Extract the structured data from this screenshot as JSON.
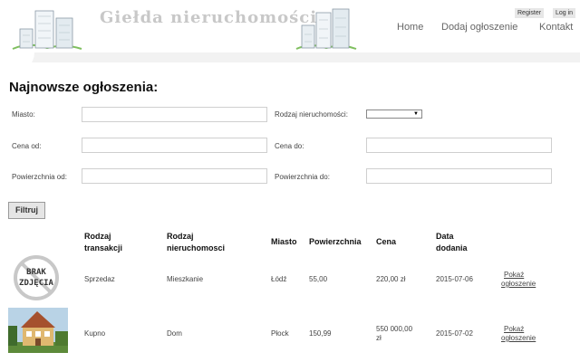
{
  "header": {
    "site_title": "Giełda nieruchomości",
    "auth": {
      "register": "Register",
      "login": "Log in"
    },
    "nav": {
      "home": "Home",
      "add": "Dodaj ogłoszenie",
      "contact": "Kontakt"
    }
  },
  "main": {
    "title": "Najnowsze ogłoszenia:",
    "filters": {
      "city_label": "Miasto:",
      "city_value": "",
      "property_type_label": "Rodzaj nieruchomości:",
      "property_type_value": "",
      "price_from_label": "Cena od:",
      "price_from_value": "",
      "price_to_label": "Cena do:",
      "price_to_value": "",
      "area_from_label": "Powierzchnia od:",
      "area_from_value": "",
      "area_to_label": "Powierzchnia do:",
      "area_to_value": "",
      "submit_label": "Filtruj"
    },
    "table": {
      "columns": [
        "Rodzaj transakcji",
        "Rodzaj nieruchomosci",
        "Miasto",
        "Powierzchnia",
        "Cena",
        "Data dodania"
      ],
      "column_lines": [
        [
          "Rodzaj",
          "transakcji"
        ],
        [
          "Rodzaj",
          "nieruchomosci"
        ],
        [
          "Miasto"
        ],
        [
          "Powierzchnia"
        ],
        [
          "Cena"
        ],
        [
          "Data",
          "dodania"
        ]
      ],
      "rows": [
        {
          "image": "BRAK ZDJĘCIA",
          "image_lines": [
            "BRAK",
            "ZDJĘCIA"
          ],
          "transaction": "Sprzedaz",
          "property_type": "Mieszkanie",
          "city": "Łódź",
          "area": "55,00",
          "price": "220,00 zł",
          "date": "2015-07-06",
          "link": "Pokaż ogłoszenie",
          "link_lines": [
            "Pokaż",
            "ogłoszenie"
          ]
        },
        {
          "image": "house-photo",
          "transaction": "Kupno",
          "property_type": "Dom",
          "city": "Płock",
          "area": "150,99",
          "price": "550 000,00 zł",
          "price_lines": [
            "550 000,00",
            "zł"
          ],
          "date": "2015-07-02",
          "link": "Pokaż ogłoszenie",
          "link_lines": [
            "Pokaż",
            "ogłoszenie"
          ]
        }
      ]
    }
  }
}
